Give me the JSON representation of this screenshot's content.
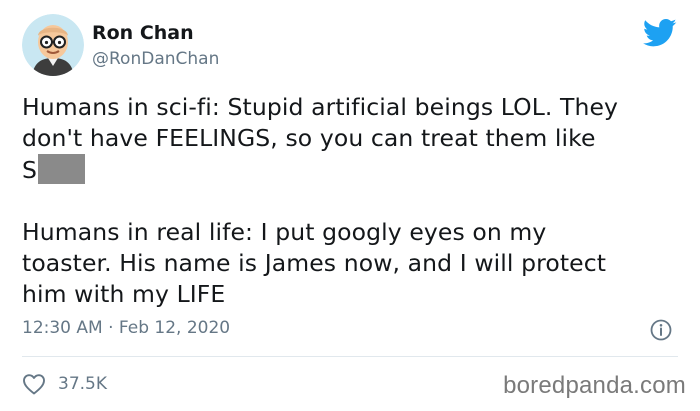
{
  "author": {
    "name": "Ron Chan",
    "handle": "@RonDanChan",
    "avatar_icon": "cartoon-avatar-with-glasses"
  },
  "brand": {
    "logo_icon": "twitter-bird-icon",
    "color": "#1da1f2"
  },
  "tweet": {
    "lines": [
      "Humans in sci-fi: Stupid artificial beings LOL. They",
      "don't have FEELINGS, so you can treat them like",
      "S",
      "",
      "Humans in real life: I put googly eyes on my",
      "toaster. His name is James now, and I will protect",
      "him with my LIFE"
    ],
    "censor_color": "#8a8a8a"
  },
  "meta": {
    "timestamp": "12:30 AM · Feb 12, 2020",
    "info_icon": "info-icon"
  },
  "actions": {
    "like_icon": "heart-icon",
    "like_count": "37.5K"
  },
  "watermark": "boredpanda.com",
  "colors": {
    "text": "#14171a",
    "secondary": "#657786",
    "divider": "#e1e8ed"
  }
}
